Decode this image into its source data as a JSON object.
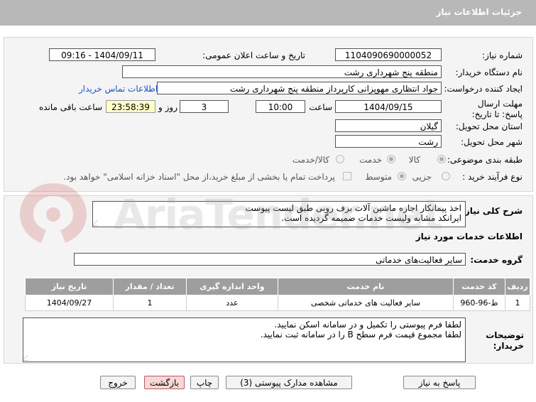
{
  "title": "جزئیات اطلاعات نیاز",
  "form": {
    "need_number_label": "شماره نیاز:",
    "need_number": "1104090690000052",
    "announce_label": "تاریخ و ساعت اعلان عمومی:",
    "announce_value": "1404/09/11 - 09:16",
    "buyer_org_label": "نام دستگاه خریدار:",
    "buyer_org": "منطقه پنج شهرداری رشت",
    "creator_label": "ایجاد کننده درخواست:",
    "creator": "جواد انتظاری مهوپزانی کارپرداز منطقه پنج شهرداری رشت",
    "contact_link": "اطلاعات تماس خریدار",
    "deadline_label": "مهلت ارسال پاسخ: تا تاریخ:",
    "deadline_date": "1404/09/15",
    "time_label": "ساعت",
    "deadline_time": "10:00",
    "days_value": "3",
    "days_label": "روز و",
    "remaining_time": "23:58:39",
    "remaining_label": "ساعت باقی مانده",
    "province_label": "استان محل تحویل:",
    "province": "گیلان",
    "city_label": "شهر محل تحویل:",
    "city": "رشت",
    "category_label": "طبقه بندی موضوعی:",
    "category_options": [
      "کالا",
      "خدمت",
      "کالا/خدمت"
    ],
    "process_label": "نوع فرآیند خرید :",
    "process_options": [
      "جزیی",
      "متوسط"
    ],
    "payment_note": "پرداخت تمام یا بخشی از مبلغ خرید،از محل \"اسناد خزانه اسلامی\" خواهد بود."
  },
  "need": {
    "summary_label": "شرح کلی نیاز:",
    "summary_line1": "اخذ پیمانکار اجاره ماشین آلات برف روبی طبق لیست پیوست",
    "summary_line2": "ایرانکد مشابه ولیست خدمات ضمیمه گردیده است.",
    "services_heading": "اطلاعات خدمات مورد نیاز",
    "group_label": "گروه خدمت:",
    "group_value": "سایر فعالیت‌های خدماتی",
    "table": {
      "headers": [
        "ردیف",
        "کد خدمت",
        "نام خدمت",
        "واحد اندازه گیری",
        "تعداد / مقدار",
        "تاریخ نیاز"
      ],
      "rows": [
        [
          "1",
          "ط-96-960",
          "سایر فعالیت های خدماتی شخصی",
          "عدد",
          "1",
          "1404/09/27"
        ]
      ]
    },
    "buyer_notes_label": "توضیحات خریدار:",
    "buyer_notes_line1": "لطفا فرم پیوستی را تکمیل و در سامانه اسکن نمایید.",
    "buyer_notes_line2": "لطفا مجموع قیمت فرم سطح B را در سامانه ثبت نمایید."
  },
  "buttons": {
    "reply": "پاسخ به نیاز",
    "attachments": "مشاهده مدارک پیوستی (3)",
    "print": "چاپ",
    "back": "بازگشت",
    "exit": "خروج"
  },
  "watermark": "AriaTender.net",
  "colors": {
    "titlebar": "#b8b8b8",
    "table_header": "#9e9e9e",
    "link": "#1a56c4"
  }
}
